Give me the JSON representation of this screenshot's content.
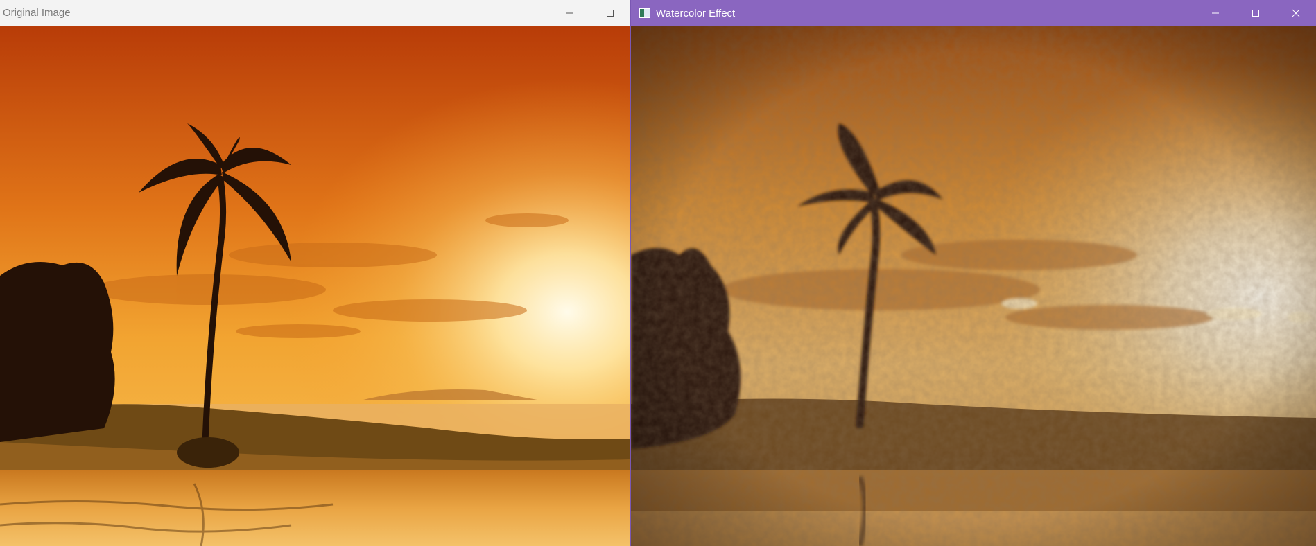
{
  "windows": {
    "original": {
      "title": "Original Image",
      "icons": [
        "minimize-icon",
        "maximize-icon"
      ]
    },
    "watercolor": {
      "title": "Watercolor Effect",
      "icons": [
        "app-icon",
        "minimize-icon",
        "maximize-icon",
        "close-icon"
      ],
      "title_bar_color": "#8a66c0"
    }
  },
  "colors": {
    "sky_top": "#c0440a",
    "sky_mid": "#e9851f",
    "sun": "#fff4d0",
    "silhouette": "#241106"
  }
}
